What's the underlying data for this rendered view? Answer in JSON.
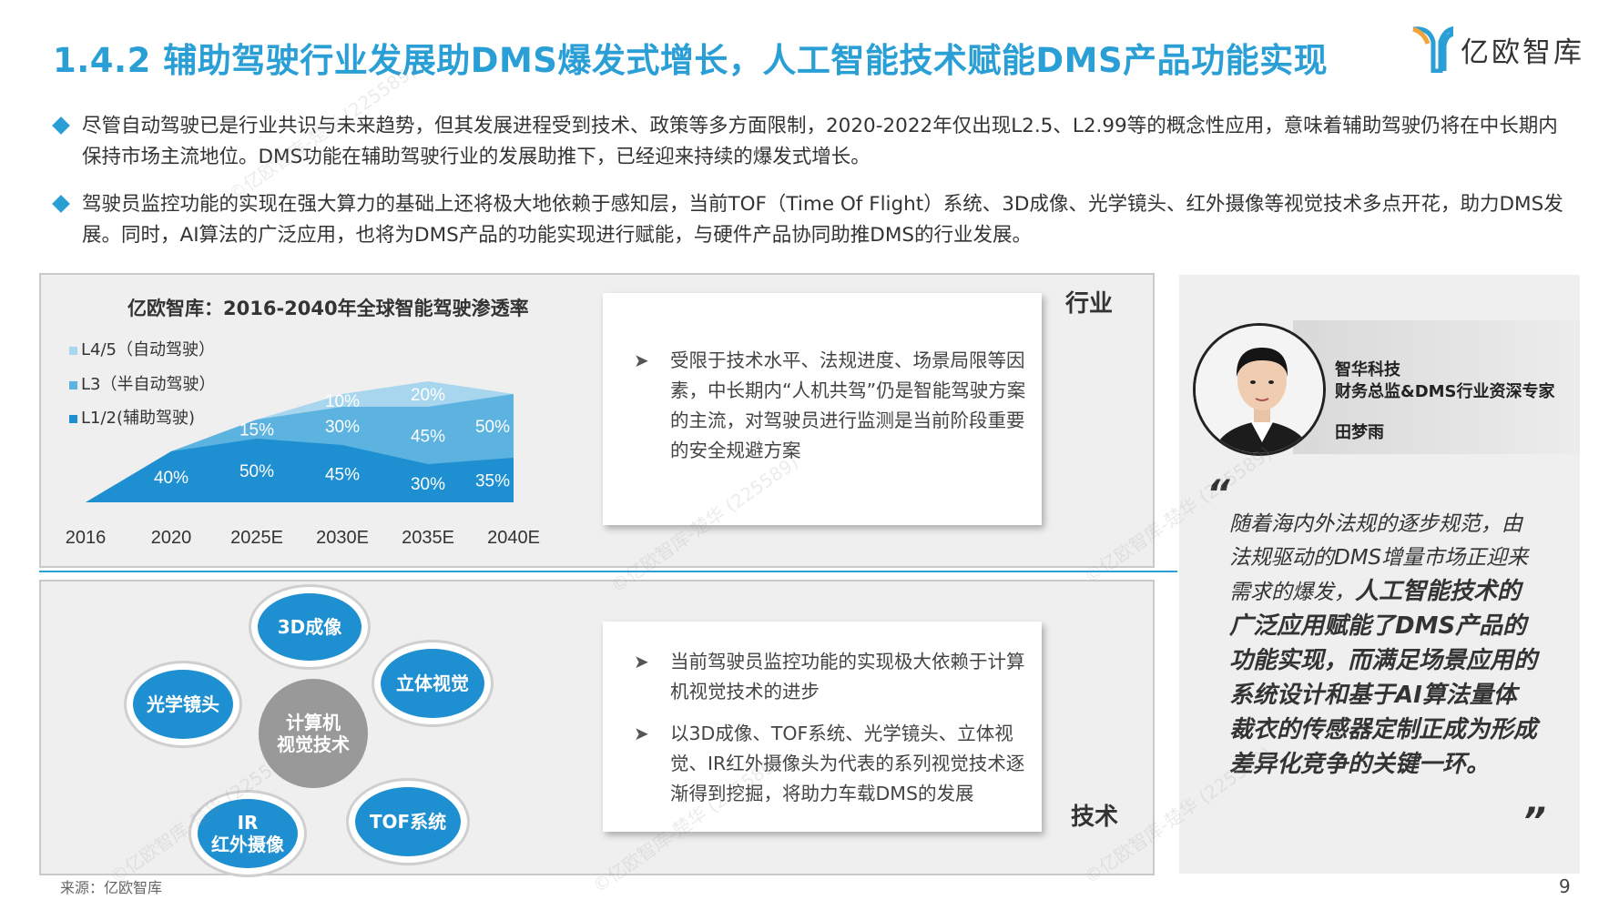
{
  "header": {
    "title": "1.4.2 辅助驾驶行业发展助DMS爆发式增长，人工智能技术赋能DMS产品功能实现",
    "logo_text": "亿欧智库"
  },
  "bullets": [
    "尽管自动驾驶已是行业共识与未来趋势，但其发展进程受到技术、政策等多方面限制，2020-2022年仅出现L2.5、L2.99等的概念性应用，意味着辅助驾驶仍将在中长期内保持市场主流地位。DMS功能在辅助驾驶行业的发展助推下，已经迎来持续的爆发式增长。",
    "驾驶员监控功能的实现在强大算力的基础上还将极大地依赖于感知层，当前TOF（Time Of Flight）系统、3D成像、光学镜头、红外摄像等视觉技术多点开花，助力DMS发展。同时，AI算法的广泛应用，也将为DMS产品的功能实现进行赋能，与硬件产品协同助推DMS的行业发展。"
  ],
  "chart_data": {
    "type": "area",
    "title": "亿欧智库：2016-2040年全球智能驾驶渗透率",
    "categories": [
      "2016",
      "2020",
      "2025E",
      "2030E",
      "2035E",
      "2040E"
    ],
    "series": [
      {
        "name": "L1/2(辅助驾驶)",
        "values": [
          null,
          40,
          50,
          45,
          30,
          35
        ],
        "color": "#1e8fd0"
      },
      {
        "name": "L3（半自动驾驶）",
        "values": [
          null,
          null,
          15,
          30,
          45,
          50
        ],
        "color": "#5cb3e0"
      },
      {
        "name": "L4/5（自动驾驶）",
        "values": [
          null,
          null,
          null,
          10,
          20,
          null
        ],
        "color": "#a7d6ee"
      }
    ],
    "stacked": true,
    "legend_position": "top-left"
  },
  "industry": {
    "tag": "行业",
    "points": [
      "受限于技术水平、法规进度、场景局限等因素，中长期内“人机共驾”仍是智能驾驶方案的主流，对驾驶员进行监测是当前阶段重要的安全规避方案"
    ]
  },
  "technology": {
    "tag": "技术",
    "center": "计算机视觉技术",
    "center_lines": [
      "计算机",
      "视觉技术"
    ],
    "bubbles": [
      "3D成像",
      "立体视觉",
      "TOF系统",
      "IR红外摄像",
      "光学镜头"
    ],
    "ir_lines": [
      "IR",
      "红外摄像"
    ],
    "points": [
      "当前驾驶员监控功能的实现极大依赖于计算机视觉技术的进步",
      "以3D成像、TOF系统、光学镜头、立体视觉、IR红外摄像头为代表的系列视觉技术逐渐得到挖掘，将助力车载DMS的发展"
    ]
  },
  "expert": {
    "company": "智华科技",
    "role": "财务总监&DMS行业资深专家",
    "name": "田梦雨"
  },
  "quote": {
    "plain": "随着海内外法规的逐步规范，由法规驱动的DMS增量市场正迎来需求的爆发，",
    "bold": "人工智能技术的广泛应用赋能了DMS产品的功能实现，而满足场景应用的系统设计和基于AI算法量体裁衣的传感器定制正成为形成差异化竞争的关键一环。",
    "open_mark": "“",
    "close_mark": "”"
  },
  "footer": {
    "source": "来源：亿欧智库",
    "page": "9"
  },
  "watermark": "©亿欧智库-楚华 (225589)"
}
